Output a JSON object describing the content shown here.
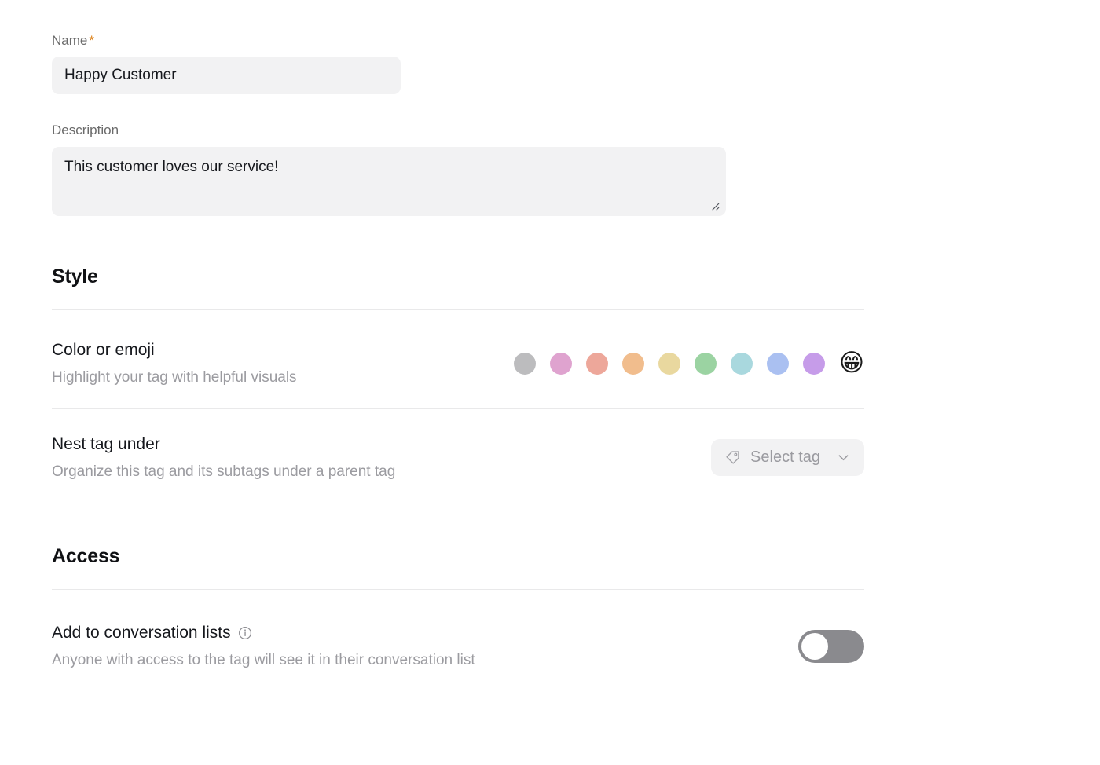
{
  "form": {
    "name": {
      "label": "Name",
      "required_marker": "*",
      "value": "Happy Customer",
      "placeholder": "Name"
    },
    "description": {
      "label": "Description",
      "value": "This customer loves our service!",
      "placeholder": "Description"
    }
  },
  "style_section": {
    "heading": "Style",
    "color_or_emoji": {
      "title": "Color or emoji",
      "subtitle": "Highlight your tag with helpful visuals",
      "swatches": [
        {
          "name": "gray",
          "hex": "#bcbcbe"
        },
        {
          "name": "pink",
          "hex": "#dfa3cf"
        },
        {
          "name": "salmon",
          "hex": "#eda79a"
        },
        {
          "name": "orange",
          "hex": "#f1bd8d"
        },
        {
          "name": "yellow",
          "hex": "#e9d89f"
        },
        {
          "name": "green",
          "hex": "#9bd3a2"
        },
        {
          "name": "teal",
          "hex": "#a9d8de"
        },
        {
          "name": "blue",
          "hex": "#aac0f1"
        },
        {
          "name": "purple",
          "hex": "#c69ce9"
        }
      ],
      "emoji_option": {
        "name": "grinning-face-with-smiling-eyes",
        "glyph": "😁"
      }
    },
    "nest_tag_under": {
      "title": "Nest tag under",
      "subtitle": "Organize this tag and its subtags under a parent tag",
      "select": {
        "label": "Select tag",
        "icon": "tag-icon",
        "chevron": "chevron-down-icon"
      }
    }
  },
  "access_section": {
    "heading": "Access",
    "add_to_conversation_lists": {
      "title": "Add to conversation lists",
      "info_icon": "info-icon",
      "subtitle": "Anyone with access to the tag will see it in their conversation list",
      "toggle": {
        "state": "off",
        "off_color": "#8a8a8e",
        "on_color": "#2f7cf6"
      }
    }
  }
}
